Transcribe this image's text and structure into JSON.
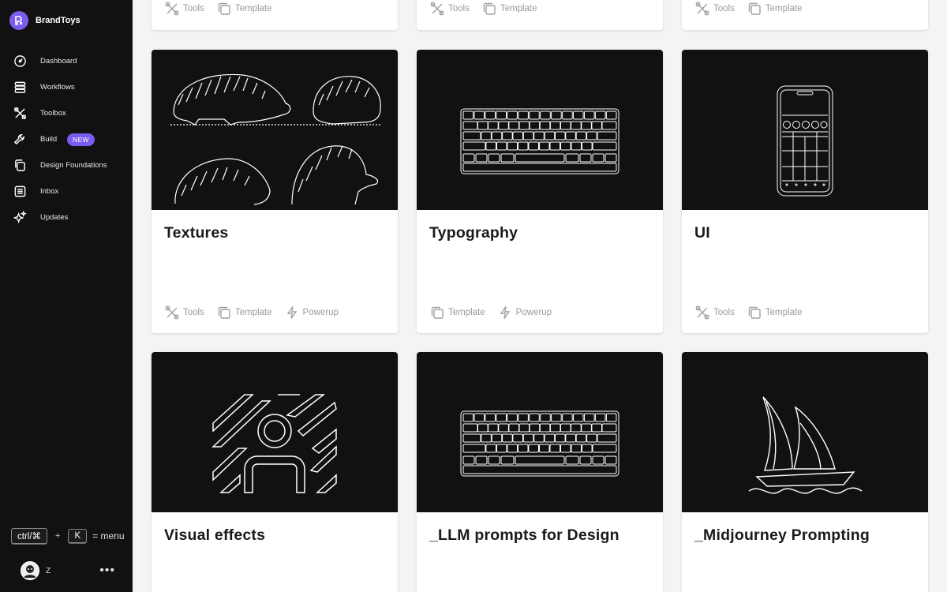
{
  "sidebar": {
    "brand": "BrandToys",
    "items": [
      {
        "label": "Dashboard",
        "icon": "gauge-icon"
      },
      {
        "label": "Workflows",
        "icon": "stack-icon"
      },
      {
        "label": "Toolbox",
        "icon": "tools-icon"
      },
      {
        "label": "Build",
        "icon": "wrench-icon",
        "badge": "NEW"
      },
      {
        "label": "Design Foundations",
        "icon": "copy-icon"
      },
      {
        "label": "Inbox",
        "icon": "inbox-icon"
      },
      {
        "label": "Updates",
        "icon": "sparkle-icon"
      }
    ],
    "shortcut": {
      "key1": "ctrl/⌘",
      "plus": "+",
      "key2": "K",
      "suffix": "= menu"
    },
    "user": {
      "initial": "Z",
      "more": "•••"
    }
  },
  "tags": {
    "tools": "Tools",
    "template": "Template",
    "powerup": "Powerup"
  },
  "cards": [
    {
      "title": "Textures",
      "image": "hedgehogs"
    },
    {
      "title": "Typography",
      "image": "keyboard"
    },
    {
      "title": "UI",
      "image": "phone"
    },
    {
      "title": "Visual effects",
      "image": "stripes-person"
    },
    {
      "title": "_LLM prompts for Design",
      "image": "keyboard"
    },
    {
      "title": "_Midjourney Prompting",
      "image": "sailboat"
    }
  ],
  "colors": {
    "accent": "#7c5cf0",
    "sidebar_bg": "#111111",
    "tag_text": "#9a9a9a"
  }
}
